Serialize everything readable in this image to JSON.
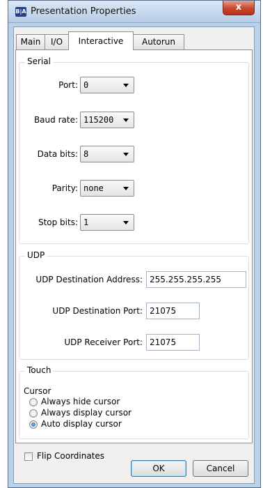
{
  "window": {
    "title": "Presentation Properties",
    "icon_text": "B|A",
    "close_label": "x"
  },
  "tabs": [
    "Main",
    "I/O",
    "Interactive",
    "Autorun"
  ],
  "serial": {
    "legend": "Serial",
    "port_label": "Port:",
    "port_value": "0",
    "baud_label": "Baud rate:",
    "baud_value": "115200",
    "databits_label": "Data bits:",
    "databits_value": "8",
    "parity_label": "Parity:",
    "parity_value": "none",
    "stopbits_label": "Stop bits:",
    "stopbits_value": "1"
  },
  "udp": {
    "legend": "UDP",
    "dest_addr_label": "UDP Destination Address:",
    "dest_addr_value": "255.255.255.255",
    "dest_port_label": "UDP Destination Port:",
    "dest_port_value": "21075",
    "recv_port_label": "UDP Receiver Port:",
    "recv_port_value": "21075"
  },
  "touch": {
    "legend": "Touch",
    "cursor_label": "Cursor",
    "options": [
      "Always hide cursor",
      "Always display cursor",
      "Auto display cursor"
    ],
    "flip_label": "Flip Coordinates"
  },
  "buttons": {
    "ok": "OK",
    "cancel": "Cancel"
  },
  "colors": {
    "accent": "#1d5fc0",
    "close": "#c9452b"
  }
}
